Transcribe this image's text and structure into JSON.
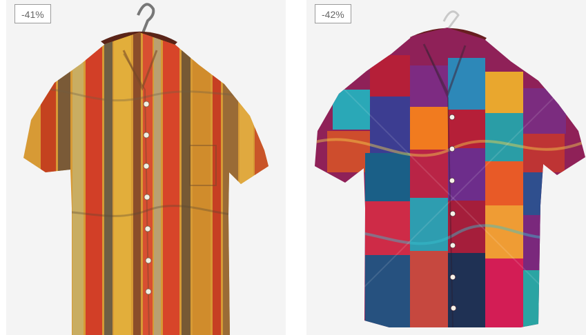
{
  "products": [
    {
      "discount": "-41%",
      "image_icon": "striped-shirt-icon",
      "colors": {
        "background": "#f4f4f4",
        "primary": "#c9582b",
        "secondary": "#d79a35",
        "accent": "#6f5f44"
      }
    },
    {
      "discount": "-42%",
      "image_icon": "patchwork-shirt-icon",
      "colors": {
        "background": "#f4f4f4",
        "primary": "#a91e40",
        "secondary": "#36a9b8",
        "accent": "#f17b1f"
      }
    }
  ]
}
